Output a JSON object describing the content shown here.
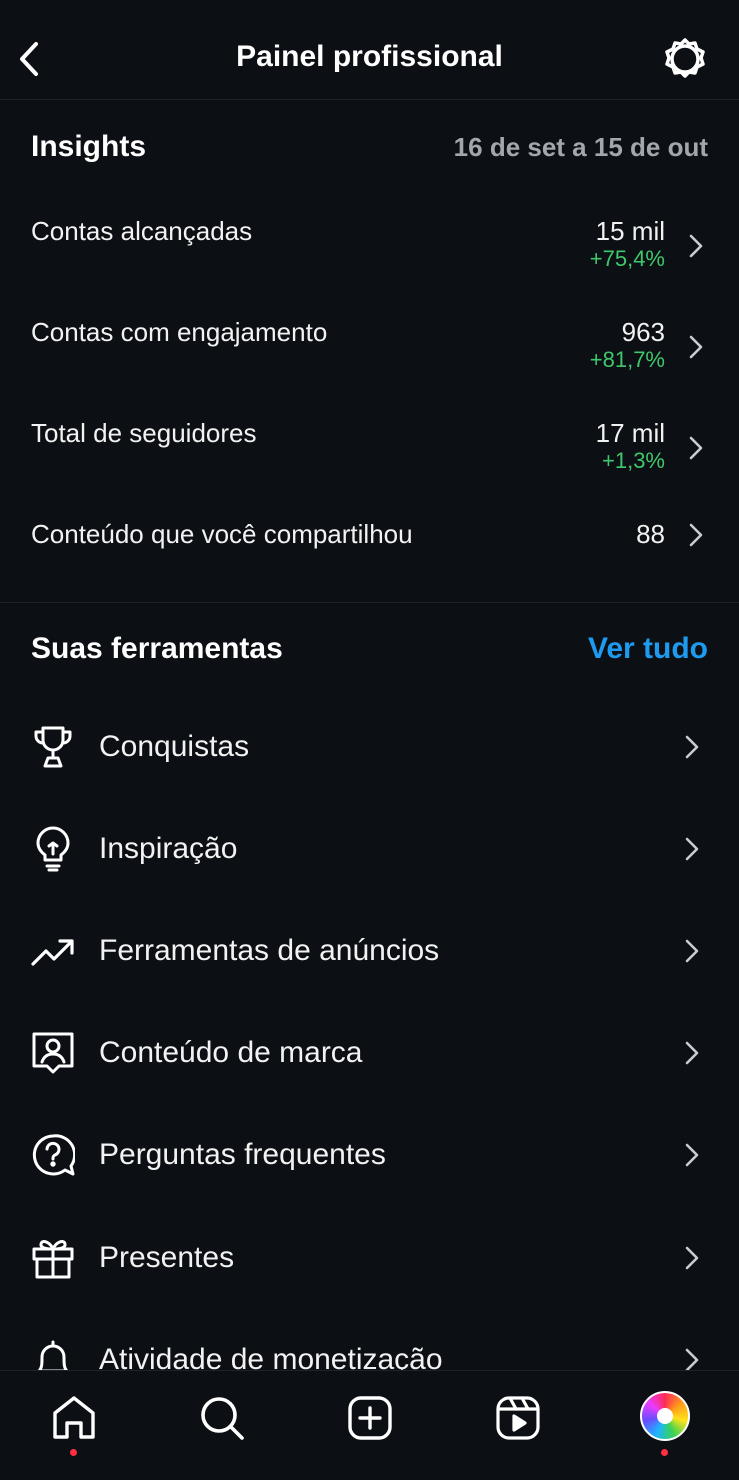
{
  "header": {
    "title": "Painel profissional"
  },
  "insights": {
    "heading": "Insights",
    "date_range": "16 de set a 15 de out",
    "metrics": [
      {
        "label": "Contas alcançadas",
        "value": "15 mil",
        "delta": "+75,4%"
      },
      {
        "label": "Contas com engajamento",
        "value": "963",
        "delta": "+81,7%"
      },
      {
        "label": "Total de seguidores",
        "value": "17 mil",
        "delta": "+1,3%"
      },
      {
        "label": "Conteúdo que você compartilhou",
        "value": "88",
        "delta": ""
      }
    ]
  },
  "tools": {
    "heading": "Suas ferramentas",
    "see_all": "Ver tudo",
    "items": [
      {
        "label": "Conquistas",
        "icon": "trophy-icon"
      },
      {
        "label": "Inspiração",
        "icon": "lightbulb-icon"
      },
      {
        "label": "Ferramentas de anúncios",
        "icon": "trending-up-icon"
      },
      {
        "label": "Conteúdo de marca",
        "icon": "branded-content-icon"
      },
      {
        "label": "Perguntas frequentes",
        "icon": "question-bubble-icon"
      },
      {
        "label": "Presentes",
        "icon": "gift-icon"
      },
      {
        "label": "Atividade de monetização",
        "icon": "bell-icon"
      }
    ]
  },
  "nav": {
    "items": [
      "home-icon",
      "search-icon",
      "create-icon",
      "reels-icon",
      "profile-avatar"
    ]
  },
  "colors": {
    "background": "#0c0f14",
    "positive": "#3ec86b",
    "accent": "#1d9bf0",
    "muted": "#a2a6ad",
    "notification_dot": "#ff3040"
  }
}
